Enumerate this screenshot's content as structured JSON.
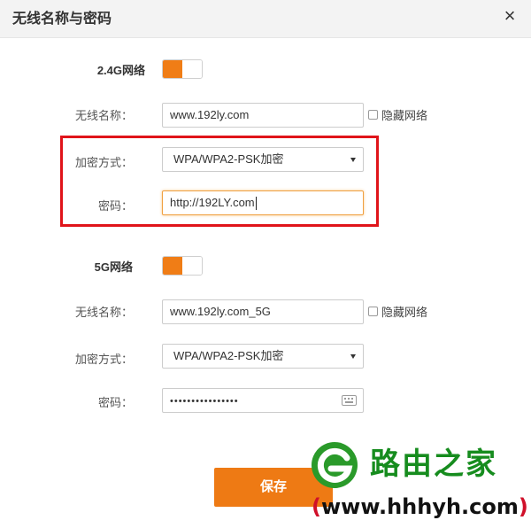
{
  "dialog": {
    "title": "无线名称与密码"
  },
  "band24": {
    "section_label": "2.4G网络",
    "enabled": true,
    "ssid_label": "无线名称：",
    "ssid_value": "www.192ly.com",
    "hide_label": "隐藏网络",
    "encryption_label": "加密方式：",
    "encryption_value": "WPA/WPA2-PSK加密",
    "password_label": "密码：",
    "password_value": "http://192LY.com"
  },
  "band5": {
    "section_label": "5G网络",
    "enabled": true,
    "ssid_label": "无线名称：",
    "ssid_value": "www.192ly.com_5G",
    "hide_label": "隐藏网络",
    "encryption_label": "加密方式：",
    "encryption_value": "WPA/WPA2-PSK加密",
    "password_label": "密码：",
    "password_masked": "••••••••••••••••"
  },
  "actions": {
    "save_label": "保存"
  },
  "watermark": {
    "brand": "路由之家",
    "url_open": "(",
    "url_text": "www.hhhyh.com",
    "url_close": ")"
  },
  "colors": {
    "accent": "#ee7a14",
    "highlight_box": "#e0141a",
    "watermark_green": "#168c1e"
  },
  "icons": {
    "close": "close-icon",
    "dropdown": "chevron-down-icon",
    "keyboard": "keyboard-icon"
  }
}
